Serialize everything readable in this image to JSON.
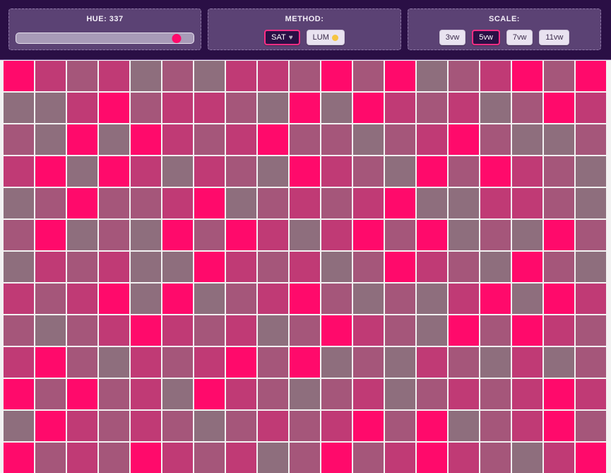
{
  "controls": {
    "hue": {
      "label": "HUE: 337",
      "value": 337,
      "min": 0,
      "max": 360
    },
    "method": {
      "label": "METHOD:",
      "options": [
        {
          "label": "SAT",
          "icon": "heart-icon",
          "active": true
        },
        {
          "label": "LUM",
          "icon": "sun-icon",
          "active": false
        }
      ]
    },
    "scale": {
      "label": "SCALE:",
      "options": [
        {
          "label": "3vw",
          "active": false
        },
        {
          "label": "5vw",
          "active": true
        },
        {
          "label": "7vw",
          "active": false
        },
        {
          "label": "11vw",
          "active": false
        }
      ]
    }
  },
  "colors": {
    "toolbar_bg": "#2a0f45",
    "panel_bg": "#5b4274",
    "accent": "#ff0a6b",
    "grid_lines": "#f2f2f2"
  },
  "grid": {
    "tile_shades": [
      [
        0,
        2,
        3,
        2,
        4,
        3,
        4,
        2,
        2,
        3,
        0,
        3,
        0,
        4,
        3,
        2,
        0,
        3,
        0
      ],
      [
        4,
        4,
        2,
        0,
        3,
        2,
        2,
        3,
        4,
        0,
        4,
        0,
        2,
        3,
        2,
        4,
        3,
        0,
        2
      ],
      [
        3,
        4,
        0,
        4,
        0,
        2,
        3,
        2,
        0,
        3,
        3,
        4,
        3,
        2,
        0,
        3,
        4,
        4,
        3
      ],
      [
        2,
        0,
        4,
        0,
        2,
        4,
        2,
        3,
        4,
        0,
        2,
        3,
        4,
        0,
        3,
        0,
        2,
        3,
        4
      ],
      [
        4,
        3,
        0,
        3,
        3,
        2,
        0,
        4,
        3,
        2,
        3,
        2,
        0,
        4,
        4,
        2,
        2,
        3,
        4
      ],
      [
        3,
        0,
        4,
        3,
        4,
        0,
        3,
        0,
        2,
        4,
        2,
        0,
        3,
        0,
        4,
        3,
        4,
        0,
        3
      ],
      [
        4,
        2,
        3,
        2,
        4,
        4,
        0,
        2,
        3,
        2,
        4,
        3,
        0,
        2,
        3,
        4,
        0,
        3,
        4
      ],
      [
        2,
        3,
        2,
        0,
        4,
        0,
        4,
        3,
        2,
        0,
        3,
        4,
        3,
        4,
        2,
        0,
        4,
        0,
        2
      ],
      [
        3,
        4,
        3,
        2,
        0,
        2,
        3,
        2,
        4,
        3,
        0,
        2,
        3,
        4,
        0,
        3,
        0,
        2,
        3
      ],
      [
        2,
        0,
        3,
        4,
        2,
        3,
        2,
        0,
        3,
        0,
        4,
        3,
        4,
        2,
        3,
        4,
        2,
        4,
        3
      ],
      [
        0,
        3,
        0,
        3,
        2,
        4,
        0,
        2,
        3,
        4,
        3,
        2,
        4,
        3,
        2,
        3,
        2,
        0,
        2
      ],
      [
        4,
        0,
        2,
        3,
        2,
        3,
        4,
        3,
        2,
        3,
        2,
        0,
        3,
        0,
        4,
        3,
        2,
        0,
        3
      ],
      [
        0,
        3,
        2,
        3,
        0,
        2,
        3,
        2,
        4,
        3,
        0,
        3,
        2,
        0,
        2,
        3,
        4,
        2,
        0
      ]
    ],
    "palette": [
      "#ff0a6b",
      "#e0206f",
      "#c03a75",
      "#a5567a",
      "#8e6e7d"
    ]
  }
}
